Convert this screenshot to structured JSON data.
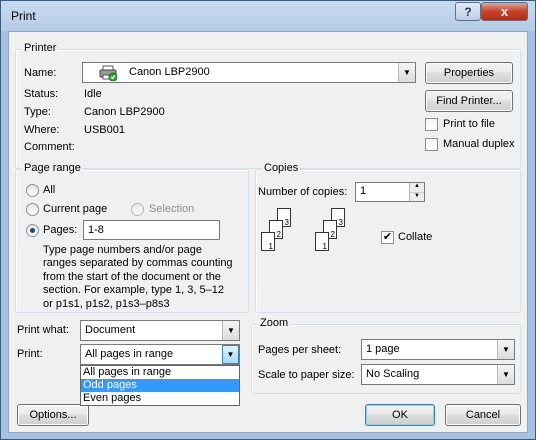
{
  "window": {
    "title": "Print",
    "help_label": "?",
    "close_label": "x"
  },
  "printer": {
    "group_title": "Printer",
    "name_label": "Name:",
    "name_value": "Canon LBP2900",
    "status_label": "Status:",
    "status_value": "Idle",
    "type_label": "Type:",
    "type_value": "Canon LBP2900",
    "where_label": "Where:",
    "where_value": "USB001",
    "comment_label": "Comment:",
    "comment_value": "",
    "properties_label": "Properties",
    "find_printer_label": "Find Printer...",
    "print_to_file_label": "Print to file",
    "print_to_file_checked": false,
    "manual_duplex_label": "Manual duplex",
    "manual_duplex_checked": false
  },
  "page_range": {
    "group_title": "Page range",
    "all_label": "All",
    "current_page_label": "Current page",
    "selection_label": "Selection",
    "pages_label": "Pages:",
    "pages_value": "1-8",
    "selected": "pages",
    "help_text_lines": [
      "Type page numbers and/or page",
      "ranges separated by commas counting",
      "from the start of the document or the",
      "section. For example, type 1, 3, 5–12",
      "or p1s1, p1s2, p1s3–p8s3"
    ]
  },
  "copies": {
    "group_title": "Copies",
    "number_label": "Number of copies:",
    "number_value": "1",
    "collate_label": "Collate",
    "collate_checked": true,
    "collate_pages": [
      "1",
      "2",
      "3"
    ]
  },
  "print_what": {
    "label": "Print what:",
    "value": "Document"
  },
  "print": {
    "label": "Print:",
    "value": "All pages in range",
    "options": [
      "All pages in range",
      "Odd pages",
      "Even pages"
    ],
    "highlighted_option": "Odd pages"
  },
  "zoom": {
    "group_title": "Zoom",
    "pages_per_sheet_label": "Pages per sheet:",
    "pages_per_sheet_value": "1 page",
    "scale_label": "Scale to paper size:",
    "scale_value": "No Scaling"
  },
  "buttons": {
    "options_label": "Options...",
    "ok_label": "OK",
    "cancel_label": "Cancel"
  },
  "colors": {
    "selection_highlight": "#3399ff",
    "titlebar_close": "#c7422a",
    "dialog_background": "#f0f0f0"
  },
  "icons": {
    "printer": "printer-icon",
    "check": "check-mark-icon",
    "dropdown": "chevron-down-icon"
  }
}
